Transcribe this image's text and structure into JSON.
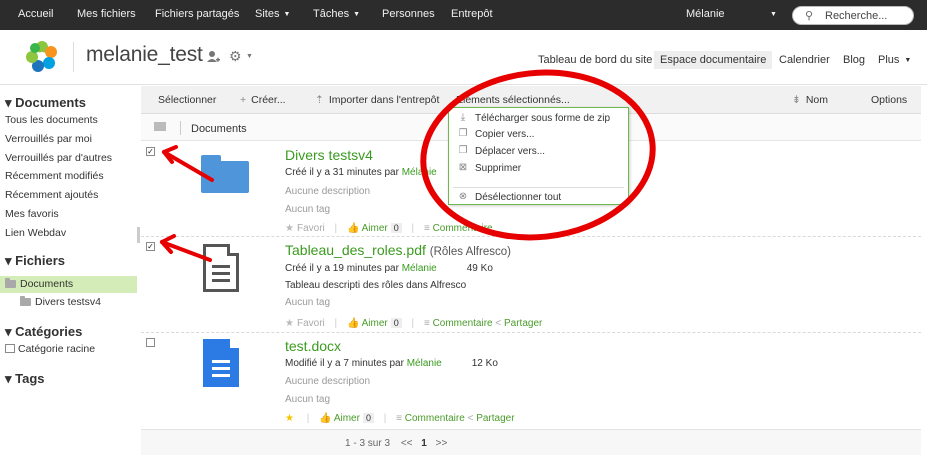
{
  "topnav": {
    "home": "Accueil",
    "my_files": "Mes fichiers",
    "shared_files": "Fichiers partagés",
    "sites": "Sites",
    "tasks": "Tâches",
    "people": "Personnes",
    "repository": "Entrepôt",
    "user": "Mélanie",
    "search_placeholder": "Recherche..."
  },
  "site": {
    "title": "melanie_test",
    "nav": {
      "dashboard": "Tableau de bord du site",
      "doclib": "Espace documentaire",
      "calendar": "Calendrier",
      "blog": "Blog",
      "more": "Plus"
    }
  },
  "sidebar": {
    "documents_header": "Documents",
    "doc_items": [
      "Tous les documents",
      "Verrouillés par moi",
      "Verrouillés par d'autres",
      "Récemment modifiés",
      "Récemment ajoutés",
      "Mes favoris",
      "Lien Webdav"
    ],
    "files_header": "Fichiers",
    "tree_root": "Documents",
    "tree_child": "Divers testsv4",
    "categories_header": "Catégories",
    "category_root": "Catégorie racine",
    "tags_header": "Tags"
  },
  "toolbar": {
    "select": "Sélectionner",
    "create": "Créer...",
    "import": "Importer dans l'entrepôt",
    "selected_items": "Eléments sélectionnés...",
    "sort": "Nom",
    "options": "Options"
  },
  "breadcrumb": {
    "current": "Documents"
  },
  "menu": {
    "items": [
      "Télécharger sous forme de zip",
      "Copier vers...",
      "Déplacer vers...",
      "Supprimer"
    ],
    "deselect_all": "Désélectionner tout"
  },
  "documents": [
    {
      "name": "Divers testsv4",
      "title_extra": "",
      "created_prefix": "Créé il y a 31 minutes par ",
      "author": "Mélanie",
      "size": "",
      "description": "Aucune description",
      "tags": "Aucun tag",
      "favorite": "Favori",
      "like": "Aimer",
      "like_count": "0",
      "comment": "Commentaire",
      "share": "",
      "checked": true
    },
    {
      "name": "Tableau_des_roles.pdf",
      "title_extra": "(Rôles Alfresco)",
      "created_prefix": "Créé il y a 19 minutes par ",
      "author": "Mélanie",
      "size": "49 Ko",
      "description": "Tableau descripti des rôles dans Alfresco",
      "tags": "Aucun tag",
      "favorite": "Favori",
      "like": "Aimer",
      "like_count": "0",
      "comment": "Commentaire",
      "share": "Partager",
      "checked": true
    },
    {
      "name": "test.docx",
      "title_extra": "",
      "created_prefix": "Modifié il y a 7 minutes par ",
      "author": "Mélanie",
      "size": "12 Ko",
      "description": "Aucune description",
      "tags": "Aucun tag",
      "favorite": "",
      "like": "Aimer",
      "like_count": "0",
      "comment": "Commentaire",
      "share": "Partager",
      "checked": false
    }
  ],
  "pagination": {
    "range": "1 - 3 sur 3",
    "prev": "<<",
    "page": "1",
    "next": ">>"
  },
  "colors": {
    "topbar": "#2c2c2c",
    "accent_green": "#3a9b1f",
    "annotation_red": "#e60000",
    "folder_blue": "#4f95d9"
  }
}
